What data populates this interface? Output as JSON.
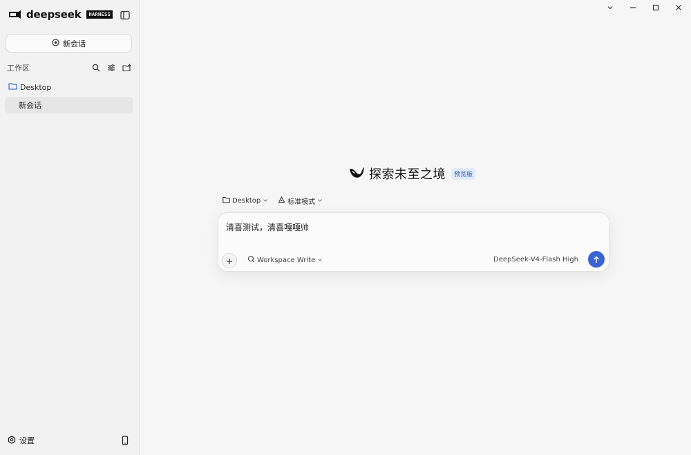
{
  "brand": {
    "name": "deepseek",
    "badge": "HARNESS"
  },
  "sidebar": {
    "new_chat_label": "新会话",
    "workspace_title": "工作区",
    "folder": {
      "name": "Desktop"
    },
    "chats": [
      {
        "title": "新会话"
      }
    ],
    "settings_label": "设置"
  },
  "main": {
    "hero_title": "探索未至之境",
    "hero_badge": "预览版",
    "workspace_chip": "Desktop",
    "mode_chip": "标准模式",
    "input_text": "清喜测试，清喜嘎嘎帅",
    "permission_mode": "Workspace Write",
    "model_label": "DeepSeek-V4-Flash High"
  },
  "colors": {
    "accent": "#3a63d3",
    "badge_text": "#2f5fc4",
    "badge_bg": "#e3ebfa",
    "folder_icon": "#3a6fd0"
  },
  "icons": {
    "logo": "deepseek-whale-icon",
    "sidebar_toggle": "sidebar-toggle-icon",
    "new_chat": "plus-circle-icon",
    "search": "search-icon",
    "filter": "sliders-icon",
    "new_folder": "folder-plus-icon",
    "folder": "folder-icon",
    "settings": "gear-icon",
    "device": "phone-icon",
    "send": "arrow-up-icon"
  }
}
